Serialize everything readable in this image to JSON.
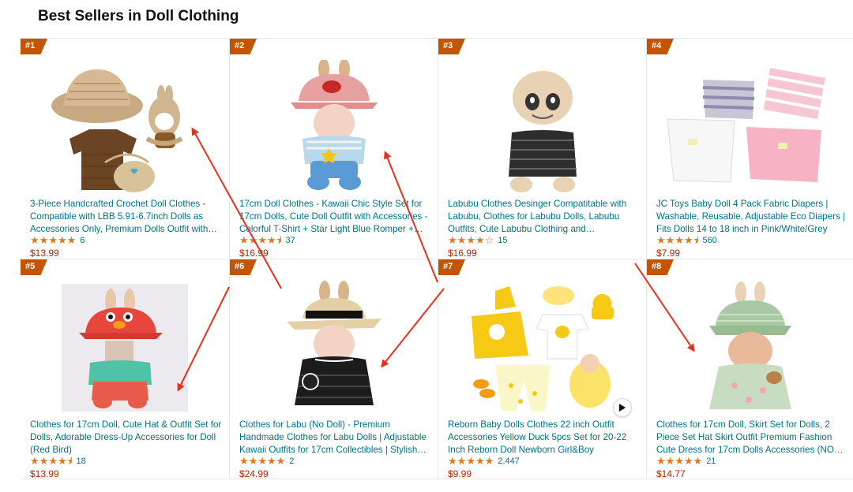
{
  "page": {
    "title": "Best Sellers in Doll Clothing"
  },
  "colors": {
    "badge": "#c45500",
    "link": "#007185",
    "price": "#b12704",
    "star": "#de7921",
    "arrow": "#e8301c"
  },
  "products": [
    {
      "rank": "#1",
      "title": "3-Piece Handcrafted Crochet Doll Clothes - Compatible with LBB 5.91-6.7inch Dolls as Accessories Only, Premium Dolls Outfit with…",
      "rating": 5,
      "reviews": "6",
      "price": "$13.99",
      "image": "crochet-hat-sweater-bag"
    },
    {
      "rank": "#2",
      "title": "17cm Doll Clothes - Kawaii Chic Style Set for 17cm Dolls, Cute Doll Outfit with Accessories - Colorful T-Shirt + Star Light Blue Romper +…",
      "rating": 4.5,
      "reviews": "37",
      "price": "$16.99",
      "image": "doll-pink-hat-blue-romper"
    },
    {
      "rank": "#3",
      "title": "Labubu Clothes Desinger Compatitable with Labubu, Clothes for Labubu Dolls, Labubu Outfits, Cute Labubu Clothing and Accessorie…",
      "rating": 4,
      "reviews": "15",
      "price": "$16.99",
      "image": "labubu-black-tweed-outfit"
    },
    {
      "rank": "#4",
      "title": "JC Toys Baby Doll 4 Pack Fabric Diapers | Washable, Reusable, Adjustable Eco Diapers | Fits Dolls 14 to 18 inch in Pink/White/Grey",
      "rating": 4.5,
      "reviews": "560",
      "price": "$7.99",
      "image": "fabric-diapers-4pack"
    },
    {
      "rank": "#5",
      "title": "Clothes for 17cm Doll, Cute Hat & Outfit Set for Dolls, Adorable Dress-Up Accessories for Doll (Red Bird)",
      "rating": 4.5,
      "reviews": "18",
      "price": "$13.99",
      "image": "doll-red-bird-outfit"
    },
    {
      "rank": "#6",
      "title": "Clothes for Labu (No Doll) - Premium Handmade Clothes for Labu Dolls | Adjustable Kawaii Outfits for 17cm Collectibles | Stylish…",
      "rating": 5,
      "reviews": "2",
      "price": "$24.99",
      "image": "doll-black-dress-hat"
    },
    {
      "rank": "#7",
      "title": "Reborn Baby Dolls Clothes 22 inch Outfit Accessories Yellow Duck 5pcs Set for 20-22 Inch Reborn Doll Newborn Girl&Boy",
      "rating": 5,
      "reviews": "2,447",
      "price": "$9.99",
      "image": "yellow-duck-5pc-set",
      "video": true
    },
    {
      "rank": "#8",
      "title": "Clothes for 17cm Doll, Skirt Set for Dolls, 2 Piece Set Hat Skirt Outfit Premium Fashion Cute Dress for 17cm Dolls Accessories (NO…",
      "rating": 5,
      "reviews": "21",
      "price": "$14.77",
      "image": "doll-green-hat-skirt"
    }
  ]
}
